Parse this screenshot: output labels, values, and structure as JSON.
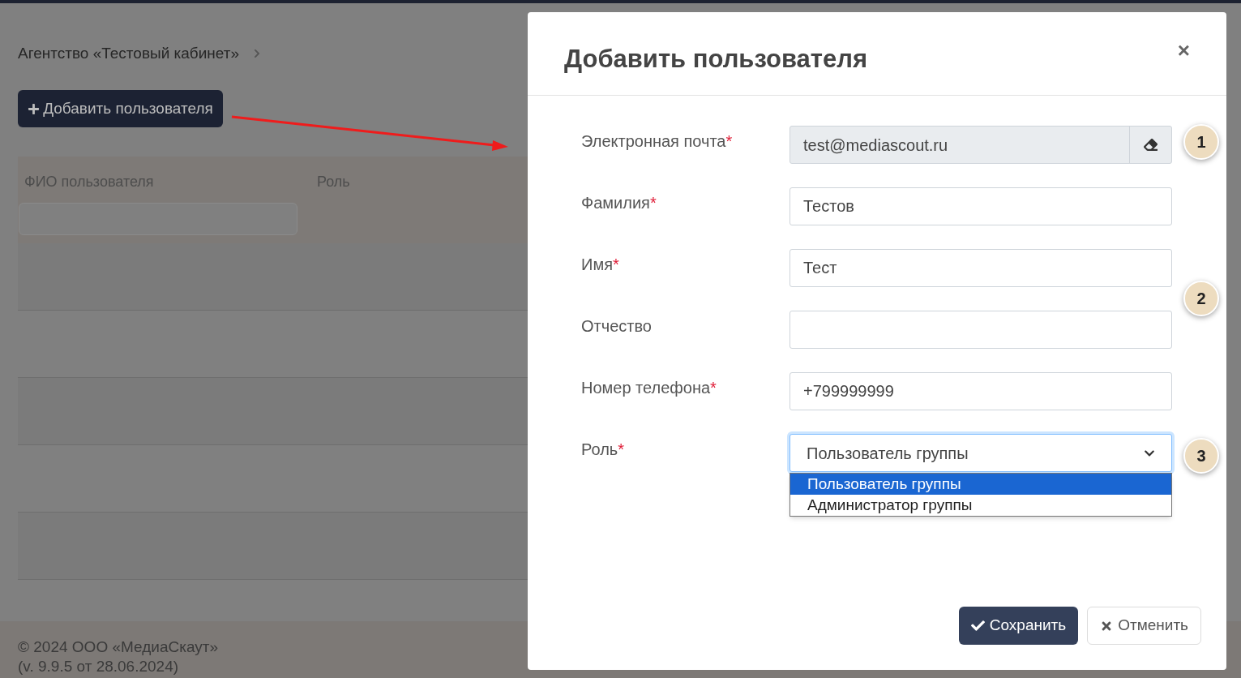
{
  "page": {
    "breadcrumb": "Агентство «Тестовый кабинет»",
    "add_button": "Добавить пользователя",
    "table": {
      "columns": [
        "ФИО пользователя",
        "Роль"
      ]
    },
    "footer": [
      "© 2024 ООО «МедиаСкаут»",
      "(v. 9.9.5 от 28.06.2024)"
    ]
  },
  "dialog": {
    "title": "Добавить пользователя",
    "close": "×",
    "fields": [
      {
        "kind": "readonly",
        "label": "Электронная почта",
        "mark": "*",
        "value": "test@mediascout.ru"
      },
      {
        "kind": "text",
        "label": "Фамилия",
        "mark": "*",
        "value": "Тестов"
      },
      {
        "kind": "text",
        "label": "Имя",
        "mark": "*",
        "value": "Тест"
      },
      {
        "kind": "text",
        "label": "Отчество"
      },
      {
        "kind": "text",
        "label": "Номер телефона",
        "mark": "*",
        "value": "+799999999"
      },
      {
        "kind": "select",
        "label": "Роль",
        "mark": "*",
        "value": "Пользователь группы",
        "expanded": true,
        "options": [
          {
            "label": "Пользователь группы",
            "selected": true
          },
          {
            "label": "Администратор группы",
            "selected": false
          }
        ]
      }
    ],
    "buttons": [
      {
        "kind": "primary",
        "label": "Сохранить"
      },
      {
        "kind": "secondary",
        "label": "Отменить"
      }
    ]
  },
  "annotations": [
    {
      "label": "1"
    },
    {
      "label": "2"
    },
    {
      "label": "3"
    }
  ]
}
